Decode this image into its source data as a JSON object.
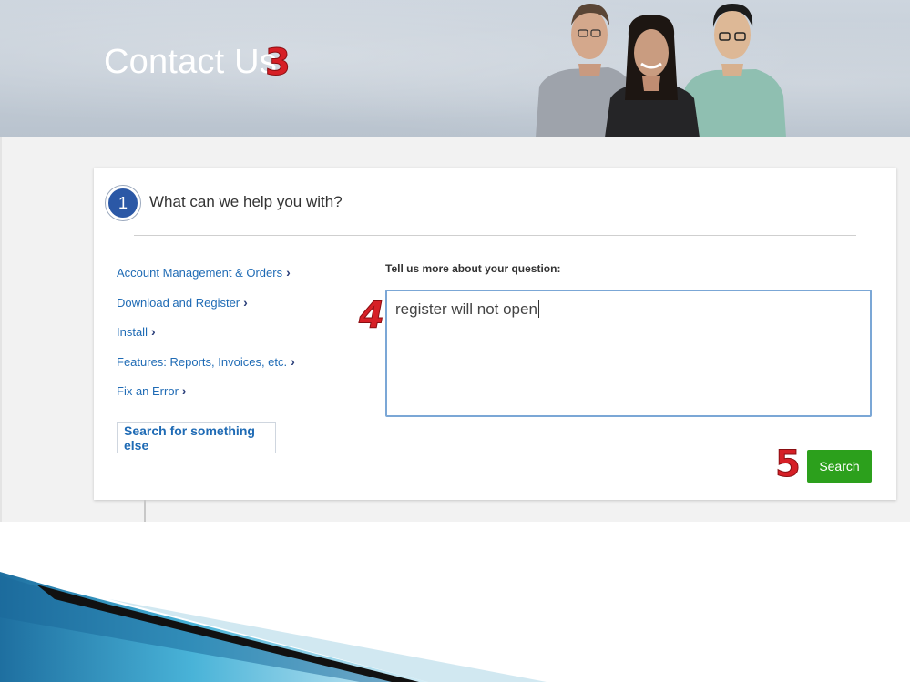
{
  "hero": {
    "title": "Contact Us",
    "marker_3": "3"
  },
  "step": {
    "number": "1",
    "title": "What can we help you with?"
  },
  "topics": [
    {
      "label": "Account Management & Orders"
    },
    {
      "label": "Download and Register"
    },
    {
      "label": "Install"
    },
    {
      "label": "Features: Reports, Invoices, etc."
    },
    {
      "label": "Fix an Error"
    }
  ],
  "search_else": {
    "label": "Search for something else"
  },
  "question": {
    "label": "Tell us more about your question:",
    "value": "register will not open",
    "marker_4": "4"
  },
  "search_button": {
    "label": "Search",
    "marker_5": "5",
    "color": "#2ca01c"
  },
  "colors": {
    "link": "#1f6bb5",
    "step_circle": "#2b58a6",
    "annotation_marker": "#d61f26"
  }
}
